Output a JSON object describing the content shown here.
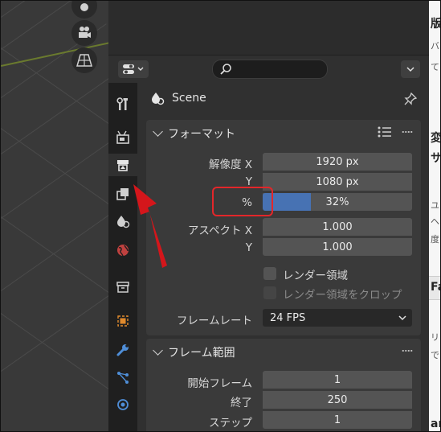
{
  "context": {
    "name": "Scene"
  },
  "format_panel": {
    "title": "フォーマット",
    "resolution_x_label": "解像度 X",
    "resolution_x_value": "1920 px",
    "resolution_y_label": "Y",
    "resolution_y_value": "1080 px",
    "percent_label": "%",
    "percent_value": "32%",
    "percent_fraction": 0.32,
    "aspect_x_label": "アスペクト X",
    "aspect_x_value": "1.000",
    "aspect_y_label": "Y",
    "aspect_y_value": "1.000",
    "render_region_label": "レンダー領域",
    "crop_region_label": "レンダー領域をクロップ",
    "framerate_label": "フレームレート",
    "framerate_value": "24 FPS"
  },
  "frame_range_panel": {
    "title": "フレーム範囲",
    "start_label": "開始フレーム",
    "start_value": "1",
    "end_label": "終了",
    "end_value": "250",
    "step_label": "ステップ",
    "step_value": "1"
  },
  "right_document": {
    "fragments": [
      "版",
      "バッ",
      "て",
      "変",
      "サ",
      "ユ",
      "ヘス",
      "度",
      "Fa",
      "リ",
      "で",
      "ar("
    ]
  },
  "colors": {
    "accent": "#4772b3",
    "annotation_red": "#e3262a"
  },
  "icons": {
    "tabs": [
      "tool-icon",
      "render-icon",
      "output-icon",
      "view-layer-icon",
      "scene-icon",
      "world-icon",
      "collection-icon",
      "object-icon",
      "modifier-icon",
      "particles-icon",
      "physics-icon"
    ]
  }
}
